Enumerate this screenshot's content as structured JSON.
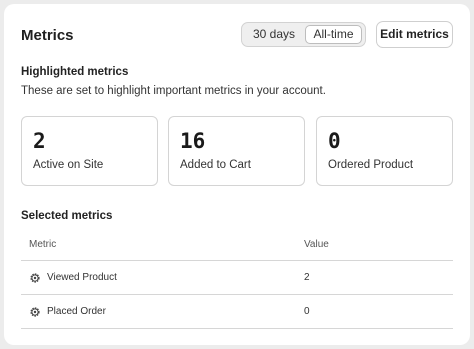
{
  "header": {
    "title": "Metrics",
    "range_options": [
      "30 days",
      "All-time"
    ],
    "range_selected": "All-time",
    "edit_label": "Edit metrics"
  },
  "highlighted": {
    "heading": "Highlighted metrics",
    "description": "These are set to highlight important metrics in your account.",
    "cards": [
      {
        "value": "2",
        "label": "Active on Site"
      },
      {
        "value": "16",
        "label": "Added to Cart"
      },
      {
        "value": "0",
        "label": "Ordered Product"
      }
    ]
  },
  "selected": {
    "heading": "Selected metrics",
    "columns": [
      "Metric",
      "Value"
    ],
    "rows": [
      {
        "icon": "gear-icon",
        "metric": "Viewed Product",
        "value": "2"
      },
      {
        "icon": "gear-icon",
        "metric": "Placed Order",
        "value": "0"
      }
    ]
  },
  "colors": {
    "background": "#ececec",
    "card": "#ffffff",
    "border": "#d4d4d4",
    "text": "#1f1f1f"
  }
}
